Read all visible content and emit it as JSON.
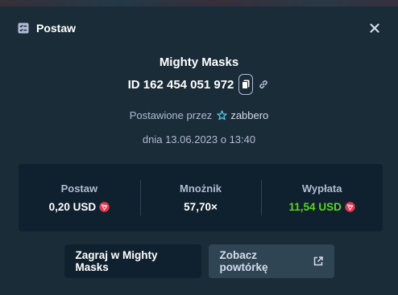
{
  "header": {
    "title": "Postaw",
    "icon": "bet-slip-icon",
    "close_icon": "close-icon"
  },
  "game": {
    "name": "Mighty Masks",
    "bet_id": "ID 162 454 051 972",
    "placed_by_prefix": "Postawione przez",
    "username": "zabbero",
    "date": "dnia 13.06.2023 o 13:40"
  },
  "stats": {
    "bet_label": "Postaw",
    "bet_value": "0,20 USD",
    "multiplier_label": "Mnożnik",
    "multiplier_value": "57,70×",
    "payout_label": "Wypłata",
    "payout_value": "11,54 USD"
  },
  "buttons": {
    "play_label": "Zagraj w Mighty Masks",
    "replay_label": "Zobacz powtórkę"
  },
  "colors": {
    "background": "#1a2c38",
    "panel": "#0f212e",
    "secondary_button": "#2f4553",
    "win_green": "#5dd323",
    "coin_red": "#e8384f",
    "muted_text": "#b1bad3"
  }
}
